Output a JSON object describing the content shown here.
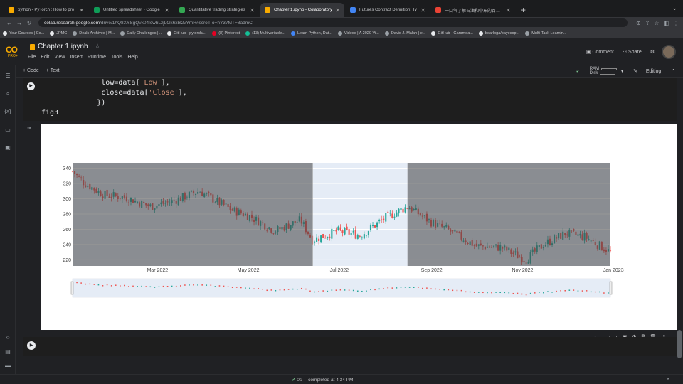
{
  "tabs": [
    {
      "label": "python - PyTorch : How to pro",
      "color": "#f9ab00",
      "active": false
    },
    {
      "label": "Untitled spreadsheet - Google",
      "color": "#0f9d58",
      "active": false
    },
    {
      "label": "Quantitative trading strategies",
      "color": "#34a853",
      "active": false
    },
    {
      "label": "Chapter 1.ipynb - Colaboratory",
      "color": "#f9ab00",
      "active": true
    },
    {
      "label": "Futures Contract Definition: Ty",
      "color": "#4285f4",
      "active": false
    },
    {
      "label": "一口气了解石油和中东的百年战争",
      "color": "#ea4335",
      "active": false
    }
  ],
  "address": {
    "url_host": "colab.research.google.com",
    "url_path": "/drive/1hQ8XYSgQvx04IcwhLzjLGk6xbl2vYmH#scrollTo=hY37MTF8admC"
  },
  "bookmarks": [
    {
      "label": "Your Courses | Co...",
      "color": "#e8eaed"
    },
    {
      "label": "JPMC",
      "color": "#e8eaed"
    },
    {
      "label": "Deals Archives | M...",
      "color": "#9aa0a6"
    },
    {
      "label": "Daily Challenges |...",
      "color": "#9aa0a6"
    },
    {
      "label": "GitHub - pytorch/...",
      "color": "#e8eaed"
    },
    {
      "label": "(8) Pinterest",
      "color": "#e60023"
    },
    {
      "label": "(13) Multivariable...",
      "color": "#14bf96"
    },
    {
      "label": "Learn Python, Dat...",
      "color": "#4285f4"
    },
    {
      "label": "Videos | A 2020 Vi...",
      "color": "#9aa0a6"
    },
    {
      "label": "David J. Malan | e...",
      "color": "#9aa0a6"
    },
    {
      "label": "GitHub - Garamda...",
      "color": "#e8eaed"
    },
    {
      "label": "bearloga/bayesop...",
      "color": "#e8eaed"
    },
    {
      "label": "Multi-Task Learnin...",
      "color": "#9aa0a6"
    }
  ],
  "colab": {
    "logo_text": "CO",
    "logo_sub": "PRO+",
    "title": "Chapter 1.ipynb",
    "menu": [
      "File",
      "Edit",
      "View",
      "Insert",
      "Runtime",
      "Tools",
      "Help"
    ],
    "comment": "Comment",
    "share": "Share",
    "add_code": "+ Code",
    "add_text": "+ Text",
    "ram": "RAM",
    "disk": "Disk",
    "editing": "Editing"
  },
  "code": {
    "line1_pre": "              low=data[",
    "line1_str": "'Low'",
    "line1_post": "],",
    "line2_pre": "              close=data[",
    "line2_str": "'Close'",
    "line2_post": "],",
    "line3": "             })",
    "line4": "fig3"
  },
  "status": {
    "time": "0s",
    "text": "completed at 4:34 PM"
  },
  "colors": {
    "up": "#26a69a",
    "down": "#ef5350",
    "accent": "#f9ab00"
  },
  "chart_data": {
    "type": "candlestick",
    "x_ticks": [
      "Mar 2022",
      "May 2022",
      "Jul 2022",
      "Sep 2022",
      "Nov 2022",
      "Jan 2023"
    ],
    "y_ticks": [
      "220",
      "240",
      "260",
      "280",
      "300",
      "320",
      "340"
    ],
    "ylim": [
      212,
      347
    ],
    "x_range": [
      "2022-01-03",
      "2022-12-30"
    ],
    "selected_range": [
      "2022-06-13",
      "2022-08-16"
    ],
    "close_path": [
      {
        "x": "2022-01-03",
        "y": 336
      },
      {
        "x": "2022-01-10",
        "y": 322
      },
      {
        "x": "2022-01-24",
        "y": 305
      },
      {
        "x": "2022-02-07",
        "y": 302
      },
      {
        "x": "2022-02-24",
        "y": 290
      },
      {
        "x": "2022-03-10",
        "y": 296
      },
      {
        "x": "2022-03-29",
        "y": 310
      },
      {
        "x": "2022-04-20",
        "y": 285
      },
      {
        "x": "2022-05-01",
        "y": 278
      },
      {
        "x": "2022-05-19",
        "y": 258
      },
      {
        "x": "2022-06-05",
        "y": 272
      },
      {
        "x": "2022-06-13",
        "y": 246
      },
      {
        "x": "2022-06-30",
        "y": 258
      },
      {
        "x": "2022-07-15",
        "y": 252
      },
      {
        "x": "2022-08-01",
        "y": 275
      },
      {
        "x": "2022-08-16",
        "y": 290
      },
      {
        "x": "2022-08-31",
        "y": 270
      },
      {
        "x": "2022-09-13",
        "y": 258
      },
      {
        "x": "2022-10-01",
        "y": 238
      },
      {
        "x": "2022-10-18",
        "y": 236
      },
      {
        "x": "2022-11-03",
        "y": 220
      },
      {
        "x": "2022-11-15",
        "y": 240
      },
      {
        "x": "2022-11-30",
        "y": 255
      },
      {
        "x": "2022-12-13",
        "y": 250
      },
      {
        "x": "2022-12-30",
        "y": 230
      }
    ]
  }
}
